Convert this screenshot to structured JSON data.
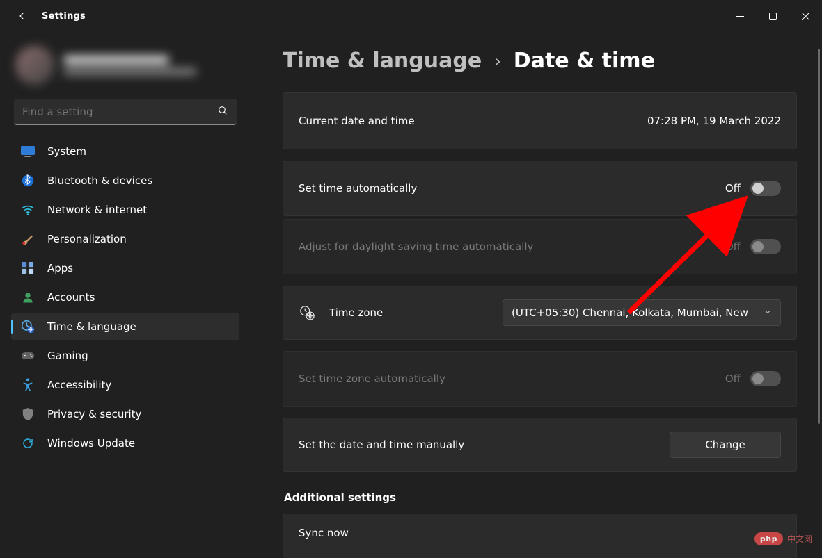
{
  "window": {
    "title": "Settings"
  },
  "search": {
    "placeholder": "Find a setting"
  },
  "sidebar": {
    "items": [
      {
        "label": "System"
      },
      {
        "label": "Bluetooth & devices"
      },
      {
        "label": "Network & internet"
      },
      {
        "label": "Personalization"
      },
      {
        "label": "Apps"
      },
      {
        "label": "Accounts"
      },
      {
        "label": "Time & language"
      },
      {
        "label": "Gaming"
      },
      {
        "label": "Accessibility"
      },
      {
        "label": "Privacy & security"
      },
      {
        "label": "Windows Update"
      }
    ]
  },
  "breadcrumb": {
    "parent": "Time & language",
    "sep": "›",
    "page": "Date & time"
  },
  "cards": {
    "current": {
      "title": "Current date and time",
      "value": "07:28 PM, 19 March 2022"
    },
    "auto_time": {
      "title": "Set time automatically",
      "state": "Off"
    },
    "dst": {
      "title": "Adjust for daylight saving time automatically",
      "state": "Off"
    },
    "timezone": {
      "title": "Time zone",
      "value": "(UTC+05:30) Chennai, Kolkata, Mumbai, New"
    },
    "auto_tz": {
      "title": "Set time zone automatically",
      "state": "Off"
    },
    "manual": {
      "title": "Set the date and time manually",
      "button": "Change"
    }
  },
  "additional": {
    "heading": "Additional settings",
    "sync": "Sync now"
  },
  "watermark": {
    "badge": "php",
    "text": "中文网"
  }
}
